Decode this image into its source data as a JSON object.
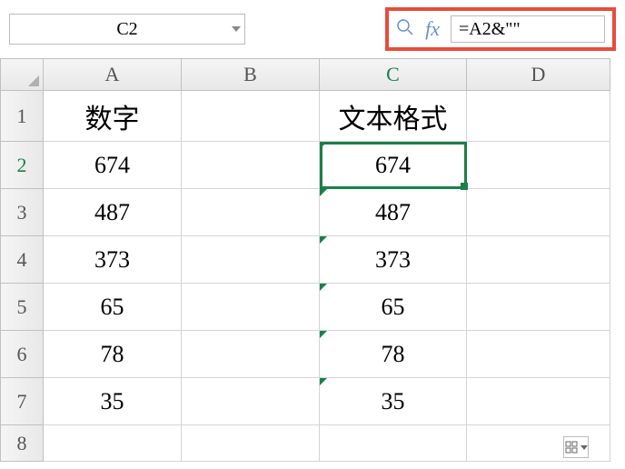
{
  "nameBox": "C2",
  "formula": "=A2&\"\"",
  "columns": [
    "A",
    "B",
    "C",
    "D"
  ],
  "rows": [
    "1",
    "2",
    "3",
    "4",
    "5",
    "6",
    "7",
    "8"
  ],
  "activeCell": "C2",
  "headers": {
    "A1": "数字",
    "C1": "文本格式"
  },
  "data": {
    "A": [
      "674",
      "487",
      "373",
      "65",
      "78",
      "35"
    ],
    "C": [
      "674",
      "487",
      "373",
      "65",
      "78",
      "35"
    ]
  },
  "chart_data": {
    "type": "table",
    "columns": [
      "数字",
      "文本格式"
    ],
    "rows": [
      [
        674,
        "674"
      ],
      [
        487,
        "487"
      ],
      [
        373,
        "373"
      ],
      [
        65,
        "65"
      ],
      [
        78,
        "78"
      ],
      [
        35,
        "35"
      ]
    ]
  }
}
